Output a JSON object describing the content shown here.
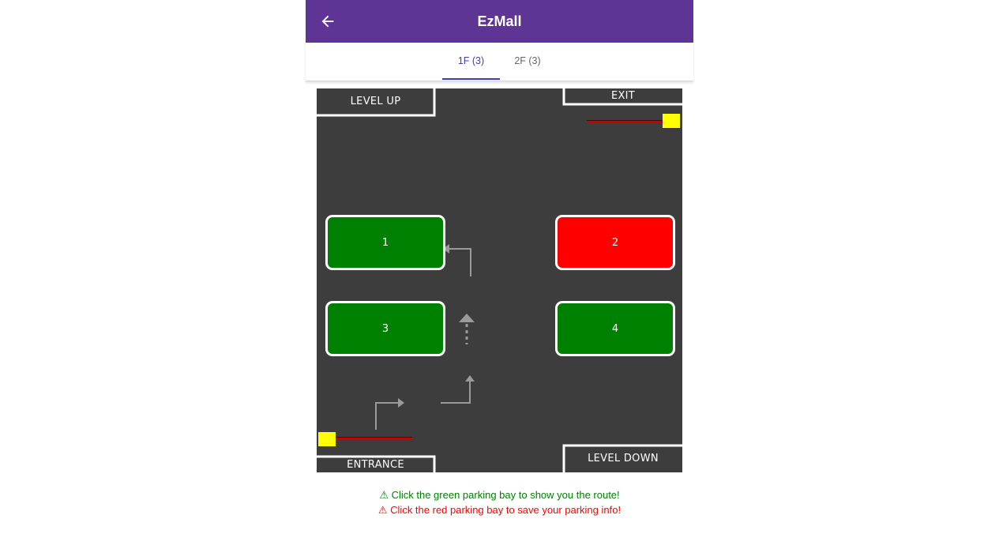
{
  "app_bar": {
    "title": "EzMall",
    "back_icon": "arrow-left-icon",
    "color": "#5e3594"
  },
  "tabs": [
    {
      "label": "1F (3)",
      "active": true
    },
    {
      "label": "2F (3)",
      "active": false
    }
  ],
  "map": {
    "background": "#3d3d3d",
    "zones": {
      "level_up": "LEVEL UP",
      "exit": "EXIT",
      "entrance": "ENTRANCE",
      "level_down": "LEVEL DOWN"
    },
    "bays": [
      {
        "number": "1",
        "status": "available",
        "color": "#008000"
      },
      {
        "number": "2",
        "status": "occupied",
        "color": "#ff0000"
      },
      {
        "number": "3",
        "status": "available",
        "color": "#008000"
      },
      {
        "number": "4",
        "status": "available",
        "color": "#008000"
      }
    ],
    "gate_color": "#ffff00",
    "barrier_color": "#cc0000",
    "route_arrow_color": "#9a9a9a"
  },
  "hints": {
    "green": "⚠ Click the green parking bay to show you the route!",
    "red": "⚠ Click the red parking bay to save your parking info!"
  }
}
